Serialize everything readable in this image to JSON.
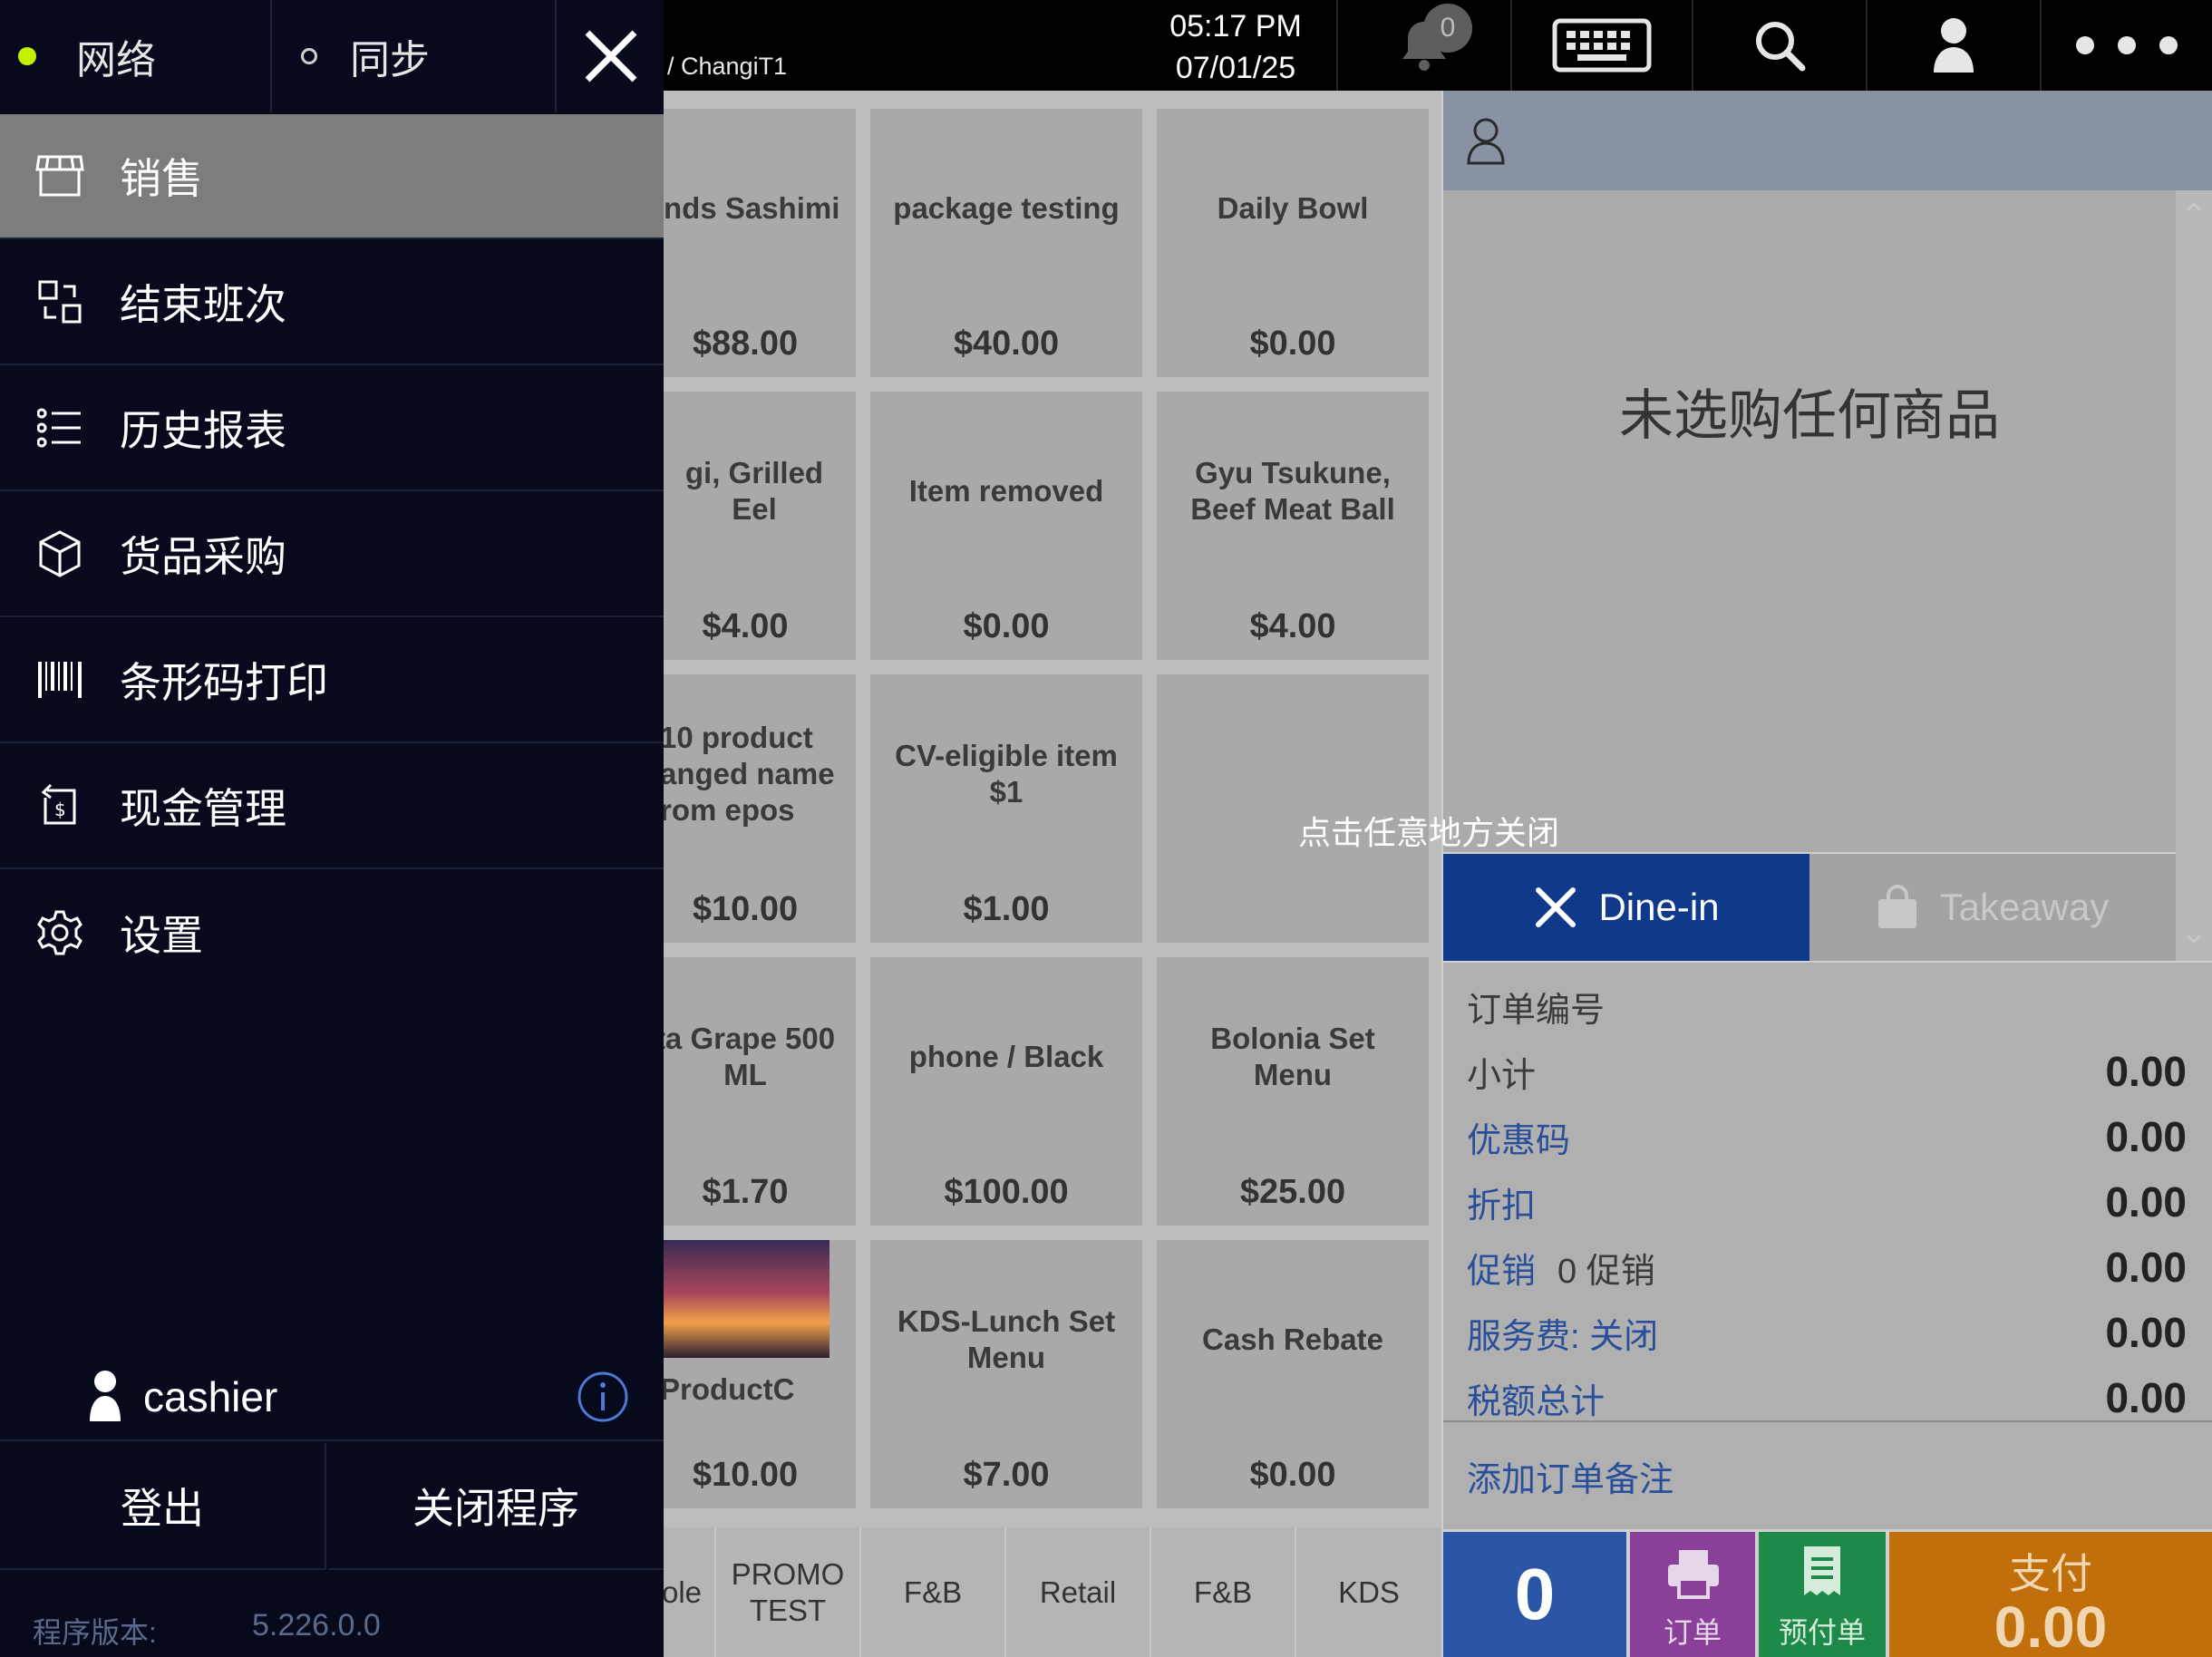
{
  "topbar": {
    "breadcrumb": "/ ChangiT1",
    "time": "05:17 PM",
    "date": "07/01/25",
    "notification_count": "0"
  },
  "products": [
    {
      "name": "nds Sashimi",
      "price": "$88.00"
    },
    {
      "name": "package testing",
      "price": "$40.00"
    },
    {
      "name": "Daily Bowl",
      "price": "$0.00"
    },
    {
      "name": "gi, Grilled Eel",
      "price": "$4.00"
    },
    {
      "name": "Item removed",
      "price": "$0.00"
    },
    {
      "name": "Gyu Tsukune, Beef Meat Ball",
      "price": "$4.00"
    },
    {
      "name": "10 product anged name rom epos",
      "price": "$10.00"
    },
    {
      "name": "CV-eligible item $1",
      "price": "$1.00"
    },
    {
      "name": "",
      "price": ""
    },
    {
      "name": "ta Grape 500 ML",
      "price": "$1.70"
    },
    {
      "name": "phone / Black",
      "price": "$100.00"
    },
    {
      "name": "Bolonia Set Menu",
      "price": "$25.00"
    },
    {
      "name": "ProductC",
      "price": "$10.00"
    },
    {
      "name": "KDS-Lunch Set Menu",
      "price": "$7.00"
    },
    {
      "name": "Cash Rebate",
      "price": "$0.00"
    }
  ],
  "categories": [
    "ole",
    "PROMO TEST",
    "F&B",
    "Retail",
    "F&B",
    "KDS"
  ],
  "cart": {
    "empty_text": "未选购任何商品",
    "dine_in": "Dine-in",
    "takeaway": "Takeaway",
    "close_hint": "点击任意地方关闭"
  },
  "summary": {
    "order_no_label": "订单编号",
    "subtotal_label": "小计",
    "subtotal": "0.00",
    "coupon_label": "优惠码",
    "coupon": "0.00",
    "discount_label": "折扣",
    "discount": "0.00",
    "promo_label": "促销",
    "promo_count": "0 促销",
    "promo": "0.00",
    "service_label": "服务费: 关闭",
    "service": "0.00",
    "tax_label": "税额总计",
    "tax": "0.00",
    "add_note": "添加订单备注"
  },
  "bottom": {
    "qty": "0",
    "order_label": "订单",
    "prepay_label": "预付单",
    "pay_label": "支付",
    "pay_amount": "0.00"
  },
  "menu": {
    "network_label": "网络",
    "sync_label": "同步",
    "items": [
      {
        "label": "销售",
        "icon": "store-icon"
      },
      {
        "label": "结束班次",
        "icon": "shift-icon"
      },
      {
        "label": "历史报表",
        "icon": "list-icon"
      },
      {
        "label": "货品采购",
        "icon": "box-icon"
      },
      {
        "label": "条形码打印",
        "icon": "barcode-icon"
      },
      {
        "label": "现金管理",
        "icon": "cash-icon"
      },
      {
        "label": "设置",
        "icon": "gear-icon"
      }
    ],
    "user": "cashier",
    "logout": "登出",
    "close_app": "关闭程序",
    "version_label": "程序版本:",
    "version": "5.226.0.0"
  },
  "colors": {
    "menu_bg": "#060a1c",
    "dine_in": "#0f3a8c",
    "qty": "#2b55a6",
    "order": "#8a3f98",
    "prepay": "#1e8a4a",
    "pay": "#c06f0a",
    "network_dot": "#c7f000"
  }
}
